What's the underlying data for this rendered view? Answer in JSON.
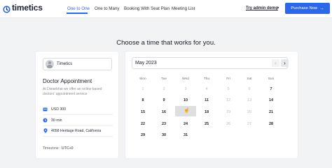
{
  "header": {
    "logo_text": "timetics",
    "nav": [
      {
        "label": "One to One",
        "active": true
      },
      {
        "label": "One to Many",
        "active": false
      },
      {
        "label": "Booking With Seat Plan",
        "active": false
      },
      {
        "label": "Meeting List",
        "active": false
      }
    ],
    "try_demo_label": "Try admin demo",
    "purchase_label": "Purchase Now",
    "accent_color": "#2d67e8"
  },
  "heading": "Choose a time that works for you.",
  "event": {
    "host_name": "Timetics",
    "title": "Doctor Appointment",
    "description": "At Distarbhai we offer an online based doctors' appointment service",
    "price": "USD 300",
    "duration": "30 min",
    "location": "4058 Heritage Road, California",
    "timezone_label": "Timezone :",
    "timezone_value": "UTC+0",
    "icons": [
      "money-icon",
      "clock-icon",
      "location-pin-icon"
    ]
  },
  "calendar": {
    "month_label": "May 2023",
    "prev_icon": "chevron-left-icon",
    "next_icon": "chevron-right-icon",
    "weekdays": [
      "Mon",
      "Tue",
      "Wed",
      "Thu",
      "Fri",
      "Sat",
      "Sun"
    ],
    "weeks": [
      [
        {
          "d": "1",
          "s": "disabled"
        },
        {
          "d": "2",
          "s": "disabled"
        },
        {
          "d": "3",
          "s": "disabled"
        },
        {
          "d": "4",
          "s": "disabled"
        },
        {
          "d": "5",
          "s": "disabled"
        },
        {
          "d": "6",
          "s": "disabled"
        },
        {
          "d": "7",
          "s": "available"
        }
      ],
      [
        {
          "d": "8",
          "s": "available"
        },
        {
          "d": "9",
          "s": "available"
        },
        {
          "d": "10",
          "s": "available"
        },
        {
          "d": "11",
          "s": "available"
        },
        {
          "d": "12",
          "s": "disabled"
        },
        {
          "d": "13",
          "s": "disabled"
        },
        {
          "d": "14",
          "s": "available"
        }
      ],
      [
        {
          "d": "15",
          "s": "available"
        },
        {
          "d": "16",
          "s": "available"
        },
        {
          "d": "",
          "s": "hover"
        },
        {
          "d": "18",
          "s": "available"
        },
        {
          "d": "19",
          "s": "disabled"
        },
        {
          "d": "20",
          "s": "disabled"
        },
        {
          "d": "21",
          "s": "available"
        }
      ],
      [
        {
          "d": "22",
          "s": "available"
        },
        {
          "d": "23",
          "s": "available"
        },
        {
          "d": "24",
          "s": "available"
        },
        {
          "d": "25",
          "s": "available"
        },
        {
          "d": "26",
          "s": "disabled"
        },
        {
          "d": "27",
          "s": "disabled"
        },
        {
          "d": "28",
          "s": "available"
        }
      ],
      [
        {
          "d": "29",
          "s": "available"
        },
        {
          "d": "30",
          "s": "available"
        },
        {
          "d": "31",
          "s": "available"
        }
      ]
    ]
  }
}
